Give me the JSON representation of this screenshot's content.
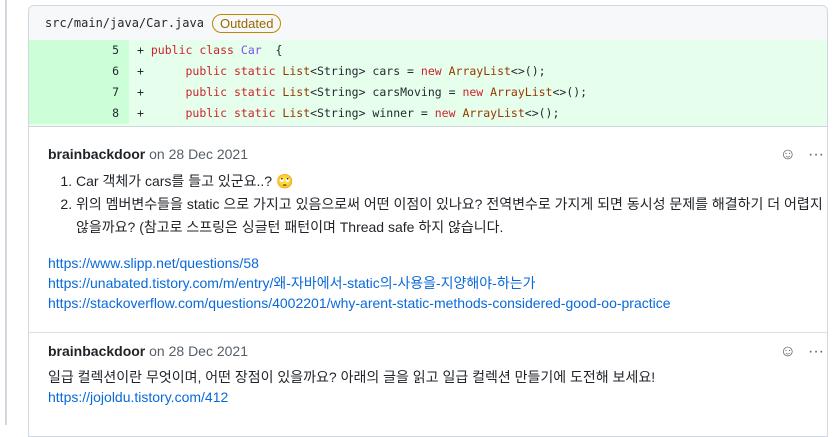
{
  "file": {
    "path": "src/main/java/Car.java",
    "badge": "Outdated"
  },
  "diff": [
    {
      "num": "5",
      "sign": "+",
      "indent": "",
      "tokens": [
        [
          "kw",
          "public class "
        ],
        [
          "cls",
          "Car"
        ],
        [
          "",
          "  {"
        ]
      ]
    },
    {
      "num": "6",
      "sign": "+",
      "indent": "     ",
      "tokens": [
        [
          "kw",
          "public static "
        ],
        [
          "ty",
          "List"
        ],
        [
          "",
          "<String> cars = "
        ],
        [
          "kw",
          "new "
        ],
        [
          "ty",
          "ArrayList"
        ],
        [
          "",
          "<>();"
        ]
      ]
    },
    {
      "num": "7",
      "sign": "+",
      "indent": "     ",
      "tokens": [
        [
          "kw",
          "public static "
        ],
        [
          "ty",
          "List"
        ],
        [
          "",
          "<String> carsMoving = "
        ],
        [
          "kw",
          "new "
        ],
        [
          "ty",
          "ArrayList"
        ],
        [
          "",
          "<>();"
        ]
      ]
    },
    {
      "num": "8",
      "sign": "+",
      "indent": "     ",
      "tokens": [
        [
          "kw",
          "public static "
        ],
        [
          "ty",
          "List"
        ],
        [
          "",
          "<String> winner = "
        ],
        [
          "kw",
          "new "
        ],
        [
          "ty",
          "ArrayList"
        ],
        [
          "",
          "<>();"
        ]
      ]
    }
  ],
  "comments": [
    {
      "author": "brainbackdoor",
      "date": "on 28 Dec 2021",
      "items": [
        "Car 객체가 cars를 들고 있군요..? 🙄",
        "위의 멤버변수들을 static 으로 가지고 있음으로써 어떤 이점이 있나요? 전역변수로 가지게 되면 동시성 문제를 해결하기 더 어렵지 않을까요? (참고로 스프링은 싱글턴 패턴이며 Thread safe 하지 않습니다."
      ],
      "links": [
        "https://www.slipp.net/questions/58",
        "https://unabated.tistory.com/m/entry/왜-자바에서-static의-사용을-지양해야-하는가",
        "https://stackoverflow.com/questions/4002201/why-arent-static-methods-considered-good-oo-practice"
      ]
    },
    {
      "author": "brainbackdoor",
      "date": "on 28 Dec 2021",
      "text": "일급 컬렉션이란 무엇이며, 어떤 장점이 있을까요? 아래의 글을 읽고 일급 컬렉션 만들기에 도전해 보세요!",
      "links": [
        "https://jojoldu.tistory.com/412"
      ]
    }
  ],
  "actions": {
    "emoji": "☺",
    "more": "···"
  }
}
